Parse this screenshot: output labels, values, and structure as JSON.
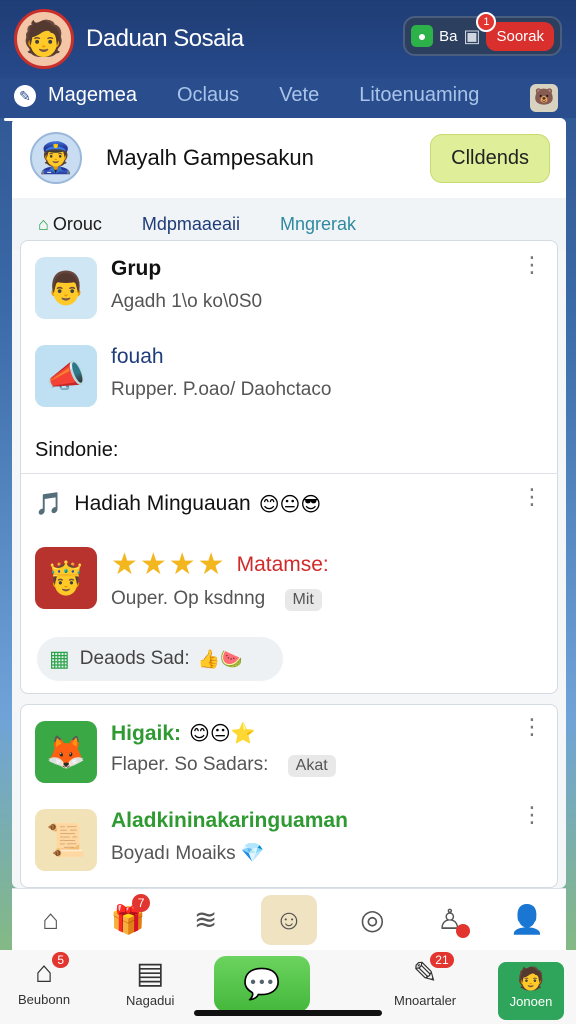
{
  "topbar": {
    "title": "Daduan Sosaia",
    "avatar_icon": "🧑",
    "small_label": "Ba",
    "action_label": "Soorak",
    "action_badge": "1"
  },
  "navtabs": [
    {
      "label": "Magemea",
      "active": true
    },
    {
      "label": "Oclaus"
    },
    {
      "label": "Vete"
    },
    {
      "label": "Litoenuaming"
    }
  ],
  "panel": {
    "title": "Mayalh Gampesakun",
    "action_label": "Clldends",
    "subtabs": [
      "Orouc",
      "Mdpmaaeaii",
      "Mngrerak"
    ]
  },
  "card1": {
    "item1": {
      "title": "Grup",
      "subtitle": "Agadh 1\\o ko\\0S0"
    },
    "item2": {
      "title": "fouah",
      "subtitle": "Rupper. P.oao/ Daohctaco"
    },
    "section_label": "Sindonie:",
    "item3": {
      "title": "Hadiah Minguauan"
    },
    "item4": {
      "red_label": "Matamse:",
      "subtitle": "Ouper. Op ksdnng",
      "tag": "Mit"
    },
    "pill_text": "Deaods Sad:"
  },
  "card2": {
    "item1": {
      "title": "Higaik:",
      "subtitle": "Flaper. So Sadars:",
      "tag": "Akat"
    },
    "item2": {
      "title": "Aladkininakaringuaman",
      "subtitle": "Boyadı Moaiks"
    }
  },
  "bottomnav": {
    "badge_count": "7"
  },
  "dock": {
    "item1": {
      "label": "Beubonn",
      "badge": "5"
    },
    "item2": {
      "label": "Nagadui"
    },
    "item3": {
      "label": "Mnoartaler",
      "badge": "21"
    },
    "item4": {
      "label": "Jonoen"
    }
  }
}
